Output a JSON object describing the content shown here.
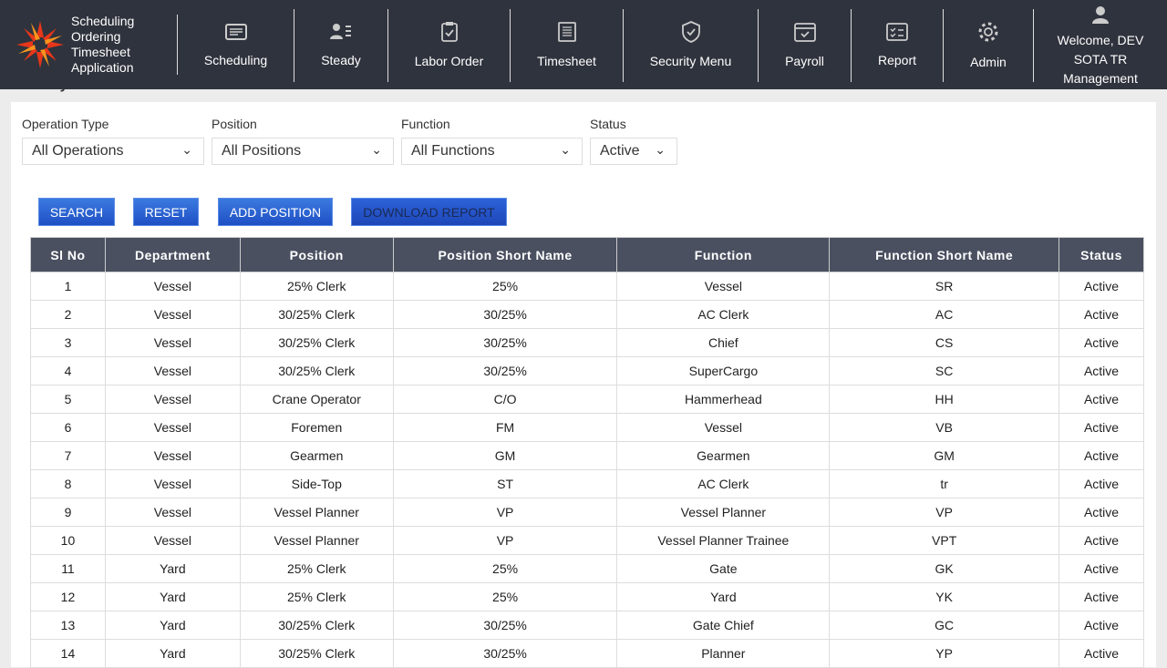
{
  "header": {
    "app_name": [
      "Scheduling",
      "Ordering",
      "Timesheet",
      "Application"
    ],
    "nav": [
      {
        "label": "Scheduling",
        "icon": "schedule-icon"
      },
      {
        "label": "Steady",
        "icon": "user-list-icon"
      },
      {
        "label": "Labor Order",
        "icon": "clipboard-check-icon"
      },
      {
        "label": "Timesheet",
        "icon": "timesheet-icon"
      },
      {
        "label": "Security Menu",
        "icon": "shield-check-icon"
      },
      {
        "label": "Payroll",
        "icon": "calendar-check-icon"
      },
      {
        "label": "Report",
        "icon": "report-icon"
      },
      {
        "label": "Admin",
        "icon": "gear-icon"
      }
    ],
    "welcome": [
      "Welcome, DEV",
      "SOTA TR",
      "Management"
    ]
  },
  "page_title": "Steady Positions & Functions",
  "filters": [
    {
      "label": "Operation Type",
      "value": "All Operations"
    },
    {
      "label": "Position",
      "value": "All Positions"
    },
    {
      "label": "Function",
      "value": "All Functions"
    },
    {
      "label": "Status",
      "value": "Active"
    }
  ],
  "buttons": {
    "search": "SEARCH",
    "reset": "RESET",
    "add": "ADD POSITION",
    "download": "DOWNLOAD REPORT"
  },
  "table": {
    "headers": [
      "Sl No",
      "Department",
      "Position",
      "Position Short Name",
      "Function",
      "Function Short Name",
      "Status"
    ],
    "rows": [
      [
        "1",
        "Vessel",
        "25% Clerk",
        "25%",
        "Vessel",
        "SR",
        "Active"
      ],
      [
        "2",
        "Vessel",
        "30/25% Clerk",
        "30/25%",
        "AC Clerk",
        "AC",
        "Active"
      ],
      [
        "3",
        "Vessel",
        "30/25% Clerk",
        "30/25%",
        "Chief",
        "CS",
        "Active"
      ],
      [
        "4",
        "Vessel",
        "30/25% Clerk",
        "30/25%",
        "SuperCargo",
        "SC",
        "Active"
      ],
      [
        "5",
        "Vessel",
        "Crane Operator",
        "C/O",
        "Hammerhead",
        "HH",
        "Active"
      ],
      [
        "6",
        "Vessel",
        "Foremen",
        "FM",
        "Vessel",
        "VB",
        "Active"
      ],
      [
        "7",
        "Vessel",
        "Gearmen",
        "GM",
        "Gearmen",
        "GM",
        "Active"
      ],
      [
        "8",
        "Vessel",
        "Side-Top",
        "ST",
        "AC Clerk",
        "tr",
        "Active"
      ],
      [
        "9",
        "Vessel",
        "Vessel Planner",
        "VP",
        "Vessel Planner",
        "VP",
        "Active"
      ],
      [
        "10",
        "Vessel",
        "Vessel Planner",
        "VP",
        "Vessel Planner Trainee",
        "VPT",
        "Active"
      ],
      [
        "11",
        "Yard",
        "25% Clerk",
        "25%",
        "Gate",
        "GK",
        "Active"
      ],
      [
        "12",
        "Yard",
        "25% Clerk",
        "25%",
        "Yard",
        "YK",
        "Active"
      ],
      [
        "13",
        "Yard",
        "30/25% Clerk",
        "30/25%",
        "Gate Chief",
        "GC",
        "Active"
      ],
      [
        "14",
        "Yard",
        "30/25% Clerk",
        "30/25%",
        "Planner",
        "YP",
        "Active"
      ]
    ]
  }
}
